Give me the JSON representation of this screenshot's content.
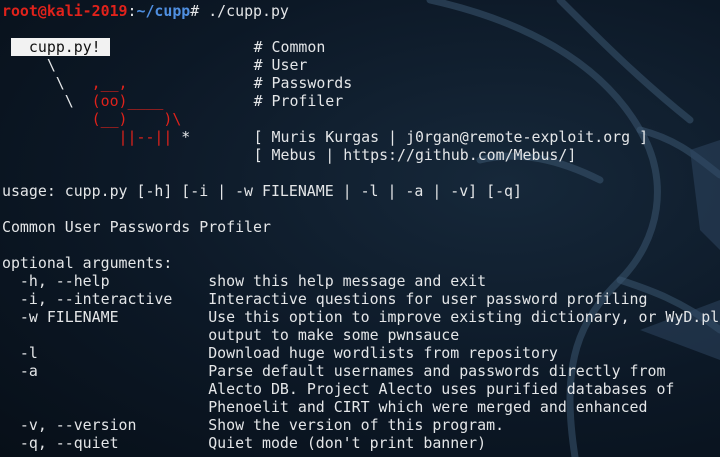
{
  "prompt": {
    "user_host": "root@kali-2019",
    "sep": ":",
    "path": "~/cupp",
    "symbol": "#",
    "command": " ./cupp.py"
  },
  "banner": {
    "box_text": "  cupp.py! ",
    "lines": [
      "            # Common",
      "            # User",
      "            # Passwords",
      "            # Profiler",
      "            [ Muris Kurgas | j0rgan@remote-exploit.org ]",
      "            [ Mebus | https://github.com/Mebus/]"
    ],
    "art": {
      "line2": "     \\",
      "line3": "      \\   ",
      "line3_red": ",__,",
      "line4_pre": "       \\  ",
      "line4_red": "(oo)____",
      "line5_pre": "          ",
      "line5_red": "(__)    )\\",
      "line6_pre": "             ",
      "line6_red": "||--||",
      "line6_star": " *"
    }
  },
  "usage": "usage: cupp.py [-h] [-i | -w FILENAME | -l | -a | -v] [-q]",
  "description": "Common User Passwords Profiler",
  "optional_header": "optional arguments:",
  "options": [
    {
      "flag": "  -h, --help           ",
      "desc": "show this help message and exit"
    },
    {
      "flag": "  -i, --interactive    ",
      "desc": "Interactive questions for user password profiling"
    },
    {
      "flag": "  -w FILENAME          ",
      "desc": "Use this option to improve existing dictionary, or WyD.pl"
    },
    {
      "flag": "                       ",
      "desc": "output to make some pwnsauce"
    },
    {
      "flag": "  -l                   ",
      "desc": "Download huge wordlists from repository"
    },
    {
      "flag": "  -a                   ",
      "desc": "Parse default usernames and passwords directly from"
    },
    {
      "flag": "                       ",
      "desc": "Alecto DB. Project Alecto uses purified databases of"
    },
    {
      "flag": "                       ",
      "desc": "Phenoelit and CIRT which were merged and enhanced"
    },
    {
      "flag": "  -v, --version        ",
      "desc": "Show the version of this program."
    },
    {
      "flag": "  -q, --quiet          ",
      "desc": "Quiet mode (don't print banner)"
    }
  ],
  "colors": {
    "background": "#0a1522",
    "text": "#e4e6e8",
    "prompt_red": "#e0221b",
    "path_blue": "#4f8fe0"
  },
  "icons": {
    "background": "kali-dragon-icon"
  }
}
